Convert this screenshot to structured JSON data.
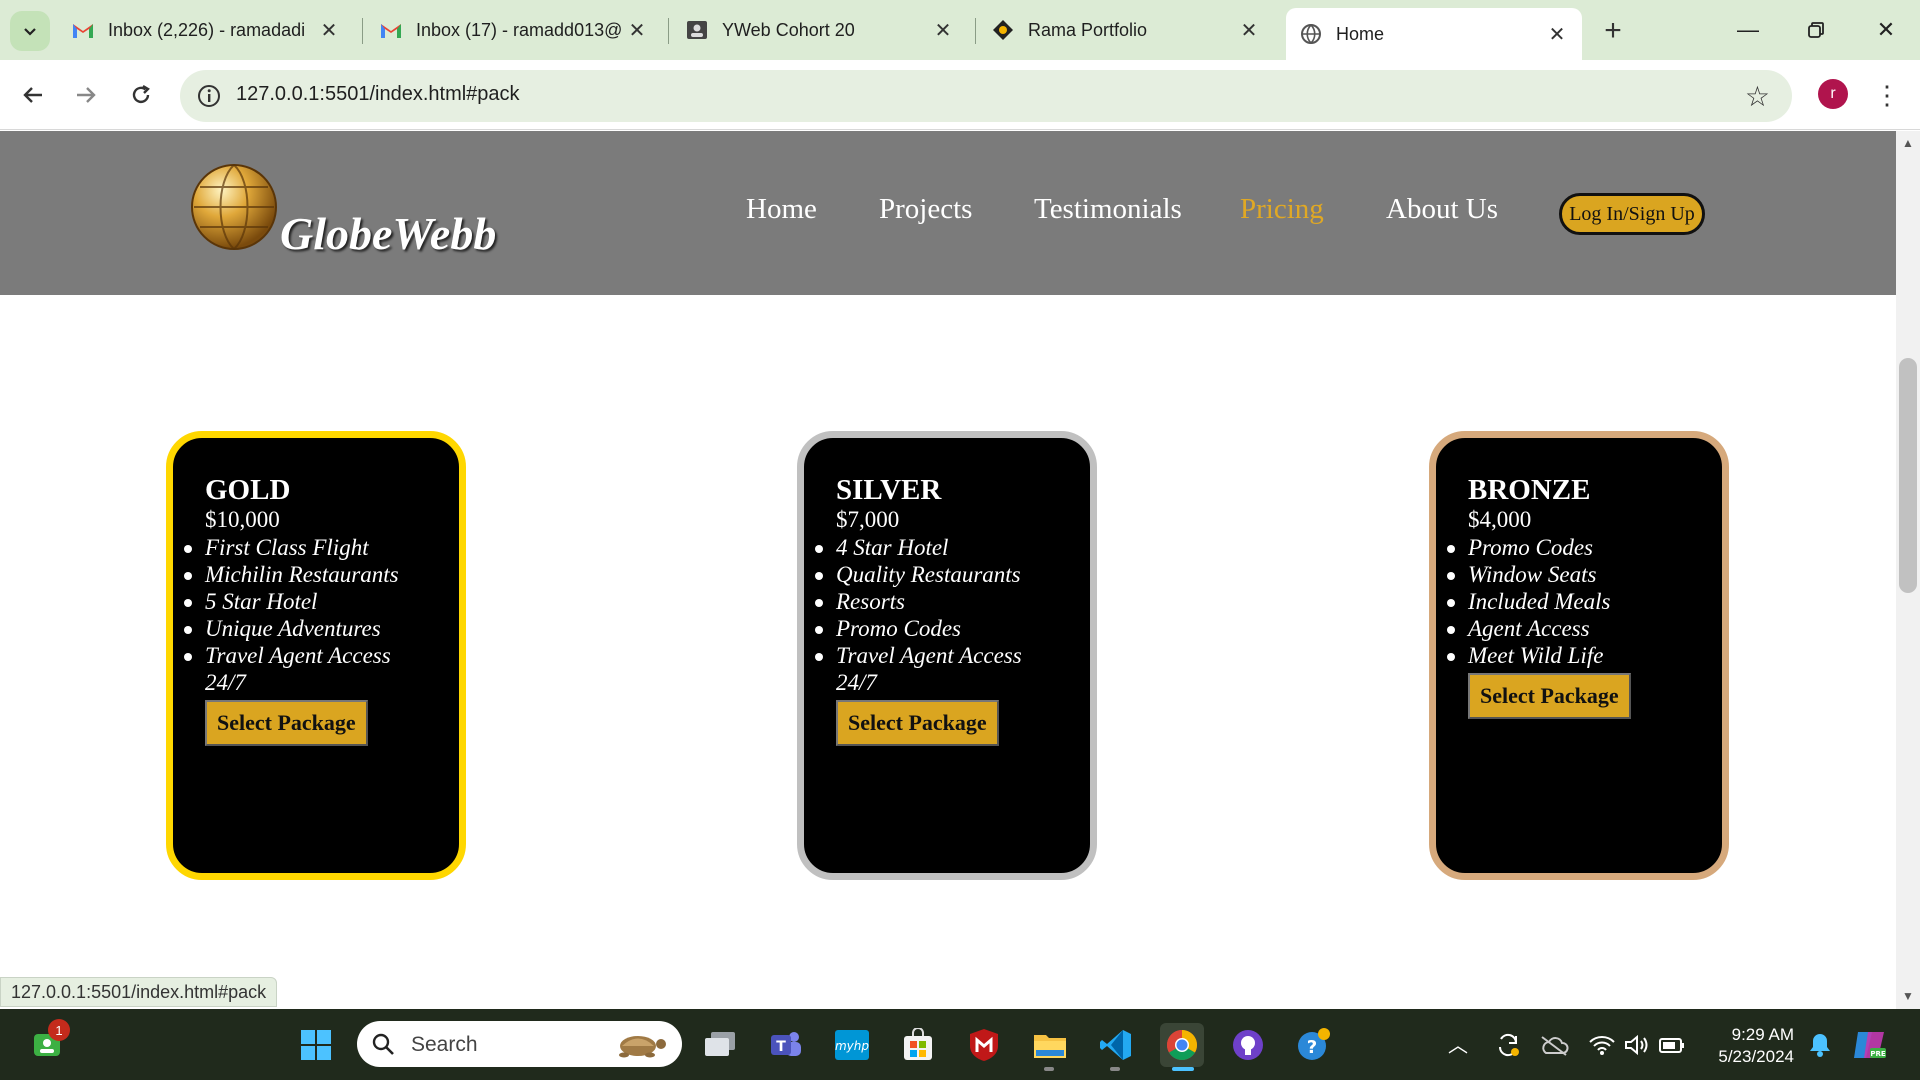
{
  "browser": {
    "tabs": [
      {
        "title": "Inbox (2,226) - ramadadi",
        "icon": "gmail-icon"
      },
      {
        "title": "Inbox (17) - ramadd013@",
        "icon": "gmail-icon"
      },
      {
        "title": "YWeb Cohort 20",
        "icon": "contact-card-icon"
      },
      {
        "title": "Rama Portfolio",
        "icon": "portfolio-icon"
      },
      {
        "title": "Home",
        "icon": "globe-icon",
        "active": true
      }
    ],
    "url": "127.0.0.1:5501/index.html#pack",
    "profile_initial": "r",
    "status_url": "127.0.0.1:5501/index.html#pack"
  },
  "site": {
    "logo_text": "GlobeWebb",
    "nav": [
      {
        "label": "Home"
      },
      {
        "label": "Projects"
      },
      {
        "label": "Testimonials"
      },
      {
        "label": "Pricing",
        "active": true
      },
      {
        "label": "About Us"
      }
    ],
    "login_label": "Log In/Sign Up"
  },
  "packages": [
    {
      "tier": "GOLD",
      "price": "$10,000",
      "features": [
        "First Class Flight",
        "Michilin Restaurants",
        "5 Star Hotel",
        "Unique Adventures",
        "Travel Agent Access 24/7"
      ],
      "button": "Select Package",
      "border_color": "#ffd700"
    },
    {
      "tier": "SILVER",
      "price": "$7,000",
      "features": [
        "4 Star Hotel",
        "Quality Restaurants",
        "Resorts",
        "Promo Codes",
        "Travel Agent Access 24/7"
      ],
      "button": "Select Package",
      "border_color": "#c0c0c0"
    },
    {
      "tier": "BRONZE",
      "price": "$4,000",
      "features": [
        "Promo Codes",
        "Window Seats",
        "Included Meals",
        "Agent Access",
        "Meet Wild Life"
      ],
      "button": "Select Package",
      "border_color": "#d6a97c"
    }
  ],
  "taskbar": {
    "search_placeholder": "Search",
    "notification_count": "1",
    "time": "9:29 AM",
    "date": "5/23/2024"
  },
  "colors": {
    "header_bg": "#7b7b7b",
    "accent_gold": "#daa520",
    "nav_active": "#e0a824"
  }
}
